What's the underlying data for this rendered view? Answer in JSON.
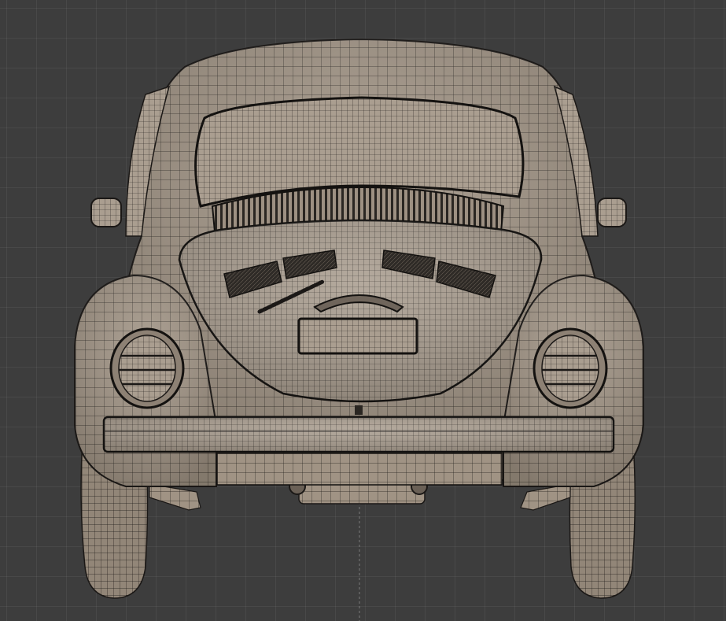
{
  "viewport": {
    "colors": {
      "background": "#3d3d3d",
      "grid": "#4a4a4a",
      "mesh_fill": "#9b8e80",
      "mesh_fill_light": "#b5a899",
      "wire": "#1c1a18",
      "center_line": "#8a8a8a"
    }
  },
  "model": {
    "object": "car-rear-wireframe"
  }
}
